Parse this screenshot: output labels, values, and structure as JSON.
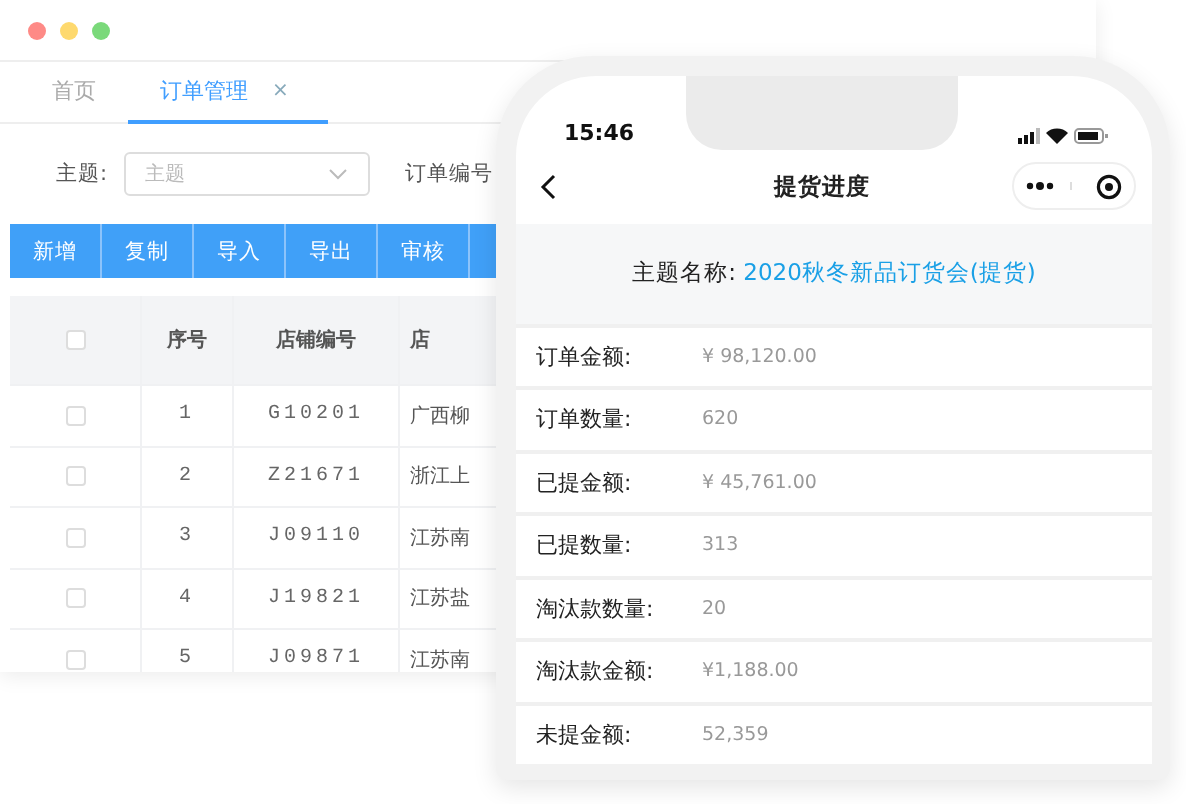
{
  "window": {
    "controls": [
      {
        "color": "#fe8a86"
      },
      {
        "color": "#fed96e"
      },
      {
        "color": "#7ad97a"
      }
    ]
  },
  "tabs": [
    {
      "label": "首页",
      "selected": false
    },
    {
      "label": "订单管理",
      "selected": true,
      "close": "×"
    }
  ],
  "filters": [
    {
      "label": "主题:",
      "placeholder": "主题",
      "kind": "select"
    },
    {
      "label": "订单编号",
      "kind": "label"
    }
  ],
  "toolbar": [
    "新增",
    "复制",
    "导入",
    "导出",
    "审核"
  ],
  "table": {
    "header_checked": false,
    "columns": [
      "序号",
      "店铺编号",
      "店"
    ],
    "rows": [
      {
        "checked": false,
        "index": "1",
        "store_code": "G10201",
        "column_3": "广西柳"
      },
      {
        "checked": false,
        "index": "2",
        "store_code": "Z21671",
        "column_3": "浙江上"
      },
      {
        "checked": false,
        "index": "3",
        "store_code": "J09110",
        "column_3": "江苏南"
      },
      {
        "checked": false,
        "index": "4",
        "store_code": "J19821",
        "column_3": "江苏盐"
      },
      {
        "checked": false,
        "index": "5",
        "store_code": "J09871",
        "column_3": "江苏南"
      }
    ]
  },
  "phone": {
    "time": "15:46",
    "title": "提货进度",
    "subject_label": "主题名称:",
    "subject": "2020秋冬新品订货会(提货)",
    "details": [
      {
        "label": "订单金额:",
        "value": "¥ 98,120.00"
      },
      {
        "label": "订单数量:",
        "value": "620"
      },
      {
        "label": "已提金额:",
        "value": "¥ 45,761.00"
      },
      {
        "label": "已提数量:",
        "value": "313"
      },
      {
        "label": "淘汰款数量:",
        "value": "20"
      },
      {
        "label": "淘汰款金额:",
        "value": "¥1,188.00"
      },
      {
        "label": "未提金额:",
        "value": "52,359"
      }
    ]
  }
}
